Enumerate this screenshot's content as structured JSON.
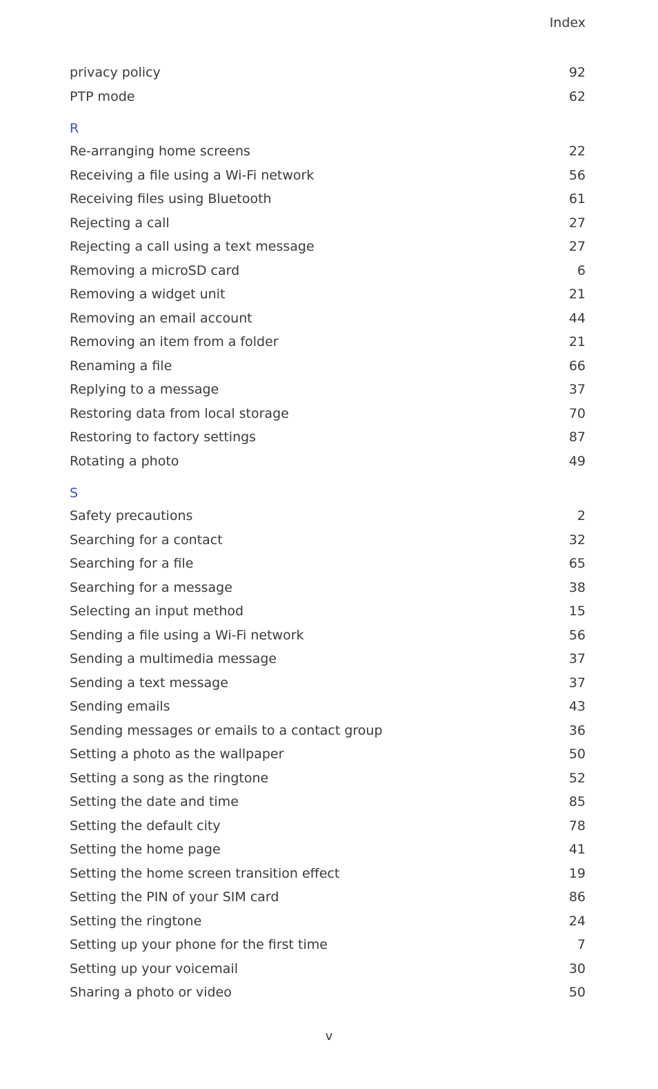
{
  "header": {
    "title": "Index"
  },
  "sections": [
    {
      "letter": "",
      "entries": [
        {
          "topic": "privacy policy",
          "page": "92"
        },
        {
          "topic": "PTP mode",
          "page": "62"
        }
      ]
    },
    {
      "letter": "R",
      "entries": [
        {
          "topic": "Re-arranging home screens",
          "page": "22"
        },
        {
          "topic": "Receiving a file using a Wi-Fi network",
          "page": "56"
        },
        {
          "topic": "Receiving files using Bluetooth",
          "page": "61"
        },
        {
          "topic": "Rejecting a call",
          "page": "27"
        },
        {
          "topic": "Rejecting a call using a text message",
          "page": "27"
        },
        {
          "topic": "Removing a microSD card",
          "page": "6"
        },
        {
          "topic": "Removing a widget unit",
          "page": "21"
        },
        {
          "topic": "Removing an email account",
          "page": "44"
        },
        {
          "topic": "Removing an item from a folder",
          "page": "21"
        },
        {
          "topic": "Renaming a file",
          "page": "66"
        },
        {
          "topic": "Replying to a message",
          "page": "37"
        },
        {
          "topic": "Restoring data from local storage",
          "page": "70"
        },
        {
          "topic": "Restoring to factory settings",
          "page": "87"
        },
        {
          "topic": "Rotating a photo",
          "page": "49"
        }
      ]
    },
    {
      "letter": "S",
      "entries": [
        {
          "topic": "Safety precautions",
          "page": "2"
        },
        {
          "topic": "Searching for a contact",
          "page": "32"
        },
        {
          "topic": "Searching for a file",
          "page": "65"
        },
        {
          "topic": "Searching for a message",
          "page": "38"
        },
        {
          "topic": "Selecting an input method",
          "page": "15"
        },
        {
          "topic": "Sending a file using a Wi-Fi network",
          "page": "56"
        },
        {
          "topic": "Sending a multimedia message",
          "page": "37"
        },
        {
          "topic": "Sending a text message",
          "page": "37"
        },
        {
          "topic": "Sending emails",
          "page": "43"
        },
        {
          "topic": "Sending messages or emails to a contact group",
          "page": "36"
        },
        {
          "topic": "Setting a photo as the wallpaper",
          "page": "50"
        },
        {
          "topic": "Setting a song as the ringtone",
          "page": "52"
        },
        {
          "topic": "Setting the date and time",
          "page": "85"
        },
        {
          "topic": "Setting the default city",
          "page": "78"
        },
        {
          "topic": "Setting the home page",
          "page": "41"
        },
        {
          "topic": "Setting the home screen transition effect",
          "page": "19"
        },
        {
          "topic": "Setting the PIN of your SIM card",
          "page": "86"
        },
        {
          "topic": "Setting the ringtone",
          "page": "24"
        },
        {
          "topic": "Setting up your phone for the first time",
          "page": "7"
        },
        {
          "topic": "Setting up your voicemail",
          "page": "30"
        },
        {
          "topic": "Sharing a photo or video",
          "page": "50"
        }
      ]
    }
  ],
  "footer": {
    "page_number": "v"
  },
  "colors": {
    "text": "#3a3a3a",
    "letter_heading": "#3c4fb5"
  }
}
